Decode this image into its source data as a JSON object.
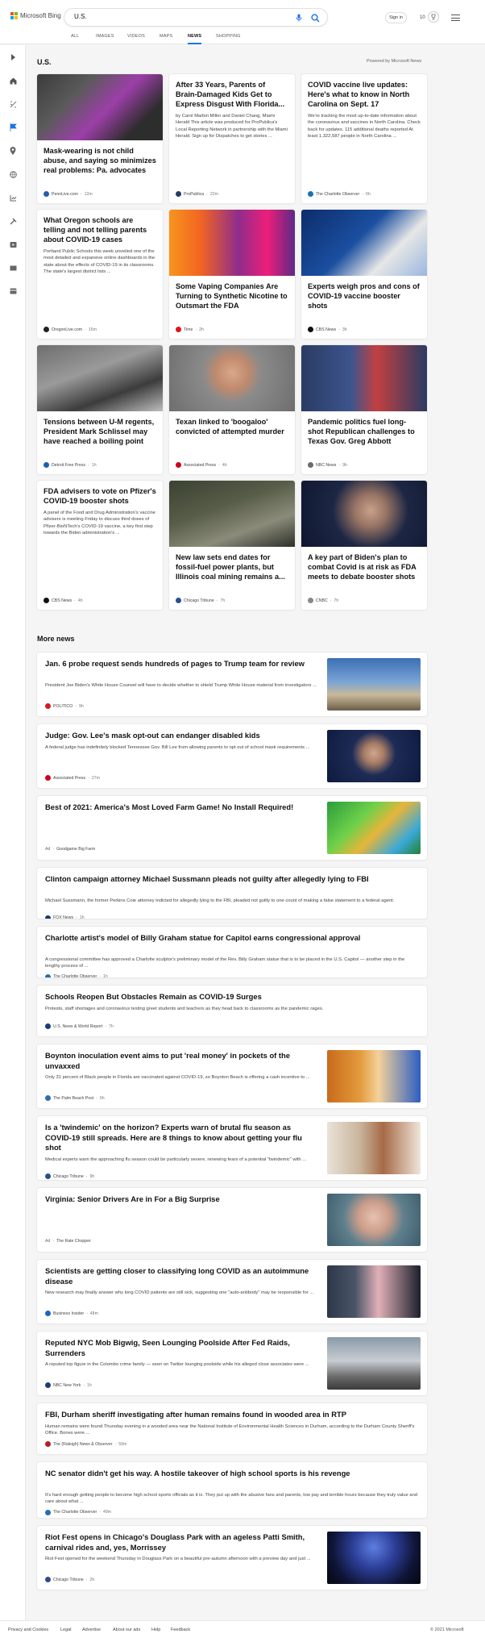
{
  "header": {
    "brand": "Microsoft Bing",
    "search_value": "U.S.",
    "sign_in": "Sign in",
    "rewards_count": "10",
    "icons": [
      "microphone-icon",
      "search-icon",
      "trophy-icon",
      "menu-icon"
    ],
    "accent": "#1a73e8"
  },
  "tabs": [
    {
      "label": "ALL"
    },
    {
      "label": "IMAGES"
    },
    {
      "label": "VIDEOS"
    },
    {
      "label": "MAPS"
    },
    {
      "label": "NEWS",
      "active": true
    },
    {
      "label": "SHOPPING"
    }
  ],
  "rail_icons": [
    "expand-icon",
    "home-icon",
    "discover-icon",
    "flag-icon",
    "local-icon",
    "world-icon",
    "business-icon",
    "sports-icon",
    "entertainment-icon",
    "videos-icon",
    "money-icon"
  ],
  "section": {
    "title": "U.S.",
    "powered": "Powered by Microsoft News"
  },
  "cards": [
    {
      "title": "Mask-wearing is not child abuse, and saying so minimizes real problems: Pa. advocates",
      "desc": "",
      "source": "PennLive.com",
      "age": "12m",
      "fav_color": "#2b5aa8",
      "img": "classroom"
    },
    {
      "title": "After 33 Years, Parents of Brain-Damaged Kids Get to Express Disgust With Florida...",
      "desc": "by Carol Marbin Miller and Daniel Chang, Miami Herald This article was produced for ProPublica's Local Reporting Network in partnership with the Miami Herald. Sign up for Dispatches to get stories ...",
      "source": "ProPublica",
      "age": "22m",
      "fav_color": "#223d66",
      "img": ""
    },
    {
      "title": "COVID vaccine live updates: Here's what to know in North Carolina on Sept. 17",
      "desc": "We're tracking the most up-to-date information about the coronavirus and vaccines in North Carolina. Check back for updates. 115 additional deaths reported At least 1,322,587 people in North Carolina ...",
      "source": "The Charlotte Observer",
      "age": "6h",
      "fav_color": "#1d6fb8",
      "img": ""
    },
    {
      "title": "What Oregon schools are telling and not telling parents about COVID-19 cases",
      "desc": "Portland Public Schools this week unveiled one of the most detailed and expansive online dashboards in the state about the effects of COVID-19 in its classrooms. The state's largest district lists ...",
      "source": "OregonLive.com",
      "age": "15m",
      "fav_color": "#222",
      "img": ""
    },
    {
      "title": "Some Vaping Companies Are Turning to Synthetic Nicotine to Outsmart the FDA",
      "desc": "",
      "source": "Time",
      "age": "2h",
      "fav_color": "#e3131c",
      "img": "vape"
    },
    {
      "title": "Experts weigh pros and cons of COVID-19 vaccine booster shots",
      "desc": "",
      "source": "CBS News",
      "age": "3h",
      "fav_color": "#111",
      "img": "vaccine"
    },
    {
      "title": "Tensions between U-M regents, President Mark Schlissel may have reached a boiling point",
      "desc": "",
      "source": "Detroit Free Press",
      "age": "1h",
      "fav_color": "#1f5fa8",
      "img": "regents"
    },
    {
      "title": "Texan linked to 'boogaloo' convicted of attempted murder",
      "desc": "",
      "source": "Associated Press",
      "age": "4h",
      "fav_color": "#d0021b",
      "img": "mugshot"
    },
    {
      "title": "Pandemic politics fuel long-shot Republican challenges to Texas Gov. Greg Abbott",
      "desc": "",
      "source": "NBC News",
      "age": "9h",
      "fav_color": "#6b6b6b",
      "img": "abbott"
    },
    {
      "title": "FDA advisers to vote on Pfizer's COVID-19 booster shots",
      "desc": "A panel of the Food and Drug Administration's vaccine advisers is meeting Friday to discuss third doses of Pfizer-BioNTech's COVID-19 vaccine, a key first step towards the Biden administration's ...",
      "source": "CBS News",
      "age": "4h",
      "fav_color": "#111",
      "img": ""
    },
    {
      "title": "New law sets end dates for fossil-fuel power plants, but Illinois coal mining remains a...",
      "desc": "",
      "source": "Chicago Tribune",
      "age": "7h",
      "fav_color": "#2a4f8c",
      "img": "aerial"
    },
    {
      "title": "A key part of Biden's plan to combat Covid is at risk as FDA meets to debate booster shots",
      "desc": "",
      "source": "CNBC",
      "age": "7h",
      "fav_color": "#888",
      "img": "biden"
    }
  ],
  "more": {
    "title": "More news",
    "items": [
      {
        "title": "Jan. 6 probe request sends hundreds of pages to Trump team for review",
        "desc": "President Joe Biden's White House Counsel will have to decide whether to shield Trump White House material from investigators ...",
        "source": "POLITICO",
        "age": "9h",
        "fav_color": "#d71920",
        "thumb": "capitol"
      },
      {
        "title": "Judge: Gov. Lee's mask opt-out can endanger disabled kids",
        "desc": "A federal judge has indefinitely blocked Tennessee Gov. Bill Lee from allowing parents to opt out of school mask requirements ...",
        "source": "Associated Press",
        "age": "27m",
        "fav_color": "#d0021b",
        "thumb": "governor"
      },
      {
        "title": "Best of 2021: America's Most Loved Farm Game! No Install Required!",
        "desc": "",
        "ad": "Ad",
        "source": "Goodgame Big Farm",
        "age": "",
        "fav_color": "",
        "thumb": "farm"
      },
      {
        "title": "Clinton campaign attorney Michael Sussmann pleads not guilty after allegedly lying to FBI",
        "desc": "Michael Sussmann, the former Perkins Coie attorney indicted for allegedly lying to the FBI, pleaded not guilty to one count of making a false statement to a federal agent.",
        "source": "FOX News",
        "age": "1h",
        "fav_color": "#17366b",
        "thumb": ""
      },
      {
        "title": "Charlotte artist's model of Billy Graham statue for Capitol earns congressional approval",
        "desc": "A congressional committee has approved a Charlotte sculptor's preliminary model of the Rev. Billy Graham statue that is to be placed in the U.S. Capitol — another step in the lengthy process of ...",
        "source": "The Charlotte Observer",
        "age": "1h",
        "fav_color": "#1d6fb8",
        "thumb": ""
      },
      {
        "title": "Schools Reopen But Obstacles Remain as COVID-19 Surges",
        "desc": "Protests, staff shortages and coronavirus testing greet students and teachers as they head back to classrooms as the pandemic rages.",
        "source": "U.S. News & World Report",
        "age": "7h",
        "fav_color": "#1a3b73",
        "thumb": ""
      },
      {
        "title": "Boynton inoculation event aims to put 'real money' in pockets of the unvaxxed",
        "desc": "Only 31 percent of Black people in Florida are vaccinated against COVID-19, so Boynton Beach is offering a cash incentive to ...",
        "source": "The Palm Beach Post",
        "age": "6h",
        "fav_color": "#2f6db5",
        "thumb": "syringe"
      },
      {
        "title": "Is a 'twindemic' on the horizon? Experts warn of brutal flu season as COVID-19 still spreads. Here are 8 things to know about getting your flu shot",
        "desc": "Medical experts warn the approaching flu season could be particularly severe, renewing fears of a potential \"twindemic\" with ...",
        "source": "Chicago Tribune",
        "age": "9h",
        "fav_color": "#2a4f8c",
        "thumb": "flushot"
      },
      {
        "title": "Virginia: Senior Drivers Are in For a Big Surprise",
        "desc": "",
        "ad": "Ad",
        "source": "The Rate Chopper",
        "age": "",
        "fav_color": "",
        "thumb": "senior"
      },
      {
        "title": "Scientists are getting closer to classifying long COVID as an autoimmune disease",
        "desc": "New research may finally answer why long COVID patients are still sick, suggesting one \"auto-antibody\" may be responsible for ...",
        "source": "Business Insider",
        "age": "48m",
        "fav_color": "#1f62c4",
        "thumb": "mask"
      },
      {
        "title": "Reputed NYC Mob Bigwig, Seen Lounging Poolside After Fed Raids, Surrenders",
        "desc": "A reputed top figure in the Colombo crime family — seen on Twitter lounging poolside while his alleged close associates were ...",
        "source": "NBC New York",
        "age": "1h",
        "fav_color": "#1c3c7a",
        "thumb": "cars"
      },
      {
        "title": "FBI, Durham sheriff investigating after human remains found in wooded area in RTP",
        "desc": "Human remains were found Thursday evening in a wooded area near the National Institute of Environmental Health Sciences in Durham, according to the Durham County Sheriff's Office. Bones were ...",
        "source": "The (Raleigh) News & Observer",
        "age": "59m",
        "fav_color": "#b22222",
        "thumb": ""
      },
      {
        "title": "NC senator didn't get his way. A hostile takeover of high school sports is his revenge",
        "desc": "It's hard enough getting people to become high school sports officials as it is. They put up with the abusive fans and parents, low pay and terrible hours because they truly value and care about what ...",
        "source": "The Charlotte Observer",
        "age": "49m",
        "fav_color": "#1d6fb8",
        "thumb": ""
      },
      {
        "title": "Riot Fest opens in Chicago's Douglass Park with an ageless Patti Smith, carnival rides and, yes, Morrissey",
        "desc": "Riot Fest opened for the weekend Thursday in Douglass Park on a beautiful pre-autumn afternoon with a preview day and just ...",
        "source": "Chicago Tribune",
        "age": "2h",
        "fav_color": "#2a4f8c",
        "thumb": "festival"
      }
    ]
  },
  "footer": {
    "links": [
      "Privacy and Cookies",
      "Legal",
      "Advertise",
      "About our ads",
      "Help",
      "Feedback"
    ],
    "copyright": "© 2021 Microsoft"
  }
}
